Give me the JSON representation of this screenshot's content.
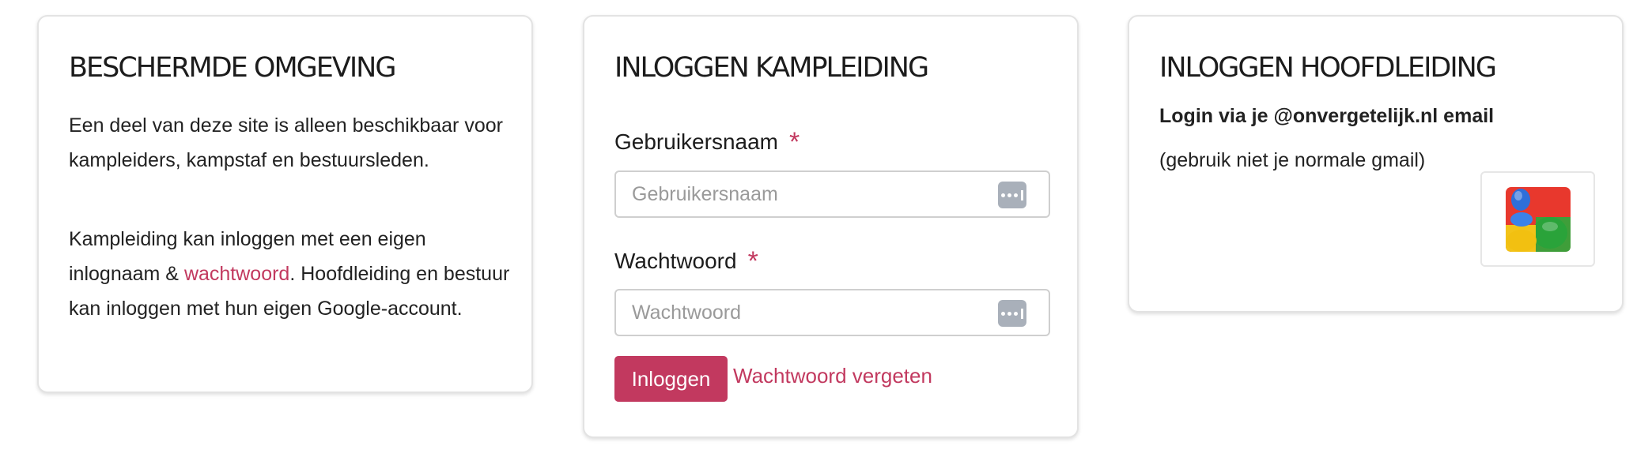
{
  "protected": {
    "title": "BESCHERMDE OMGEVING",
    "para1": "Een deel van deze site is alleen beschikbaar voor kampleiders, kampstaf en bestuursleden.",
    "para2_before": "Kampleiding kan inloggen met een eigen inlognaam & ",
    "para2_link": "wachtwoord",
    "para2_after": ". Hoofdleiding en bestuur kan inloggen met hun eigen Google-account."
  },
  "camp_login": {
    "title": "INLOGGEN KAMPLEIDING",
    "username_label": "Gebruikersnaam",
    "username_placeholder": "Gebruikersnaam",
    "username_value": "",
    "password_label": "Wachtwoord",
    "password_placeholder": "Wachtwoord",
    "password_value": "",
    "required_marker": "*",
    "submit_label": "Inloggen",
    "forgot_label": "Wachtwoord vergeten"
  },
  "head_login": {
    "title": "INLOGGEN HOOFDLEIDING",
    "login_via": "Login via je @onvergetelijk.nl email",
    "note": "(gebruik niet je normale gmail)",
    "google_icon": "google-logo-icon"
  },
  "colors": {
    "accent": "#c2395f",
    "border": "#e3e3e3",
    "input_border": "#cfcfcf",
    "password_icon_bg": "#a9b0ba"
  }
}
